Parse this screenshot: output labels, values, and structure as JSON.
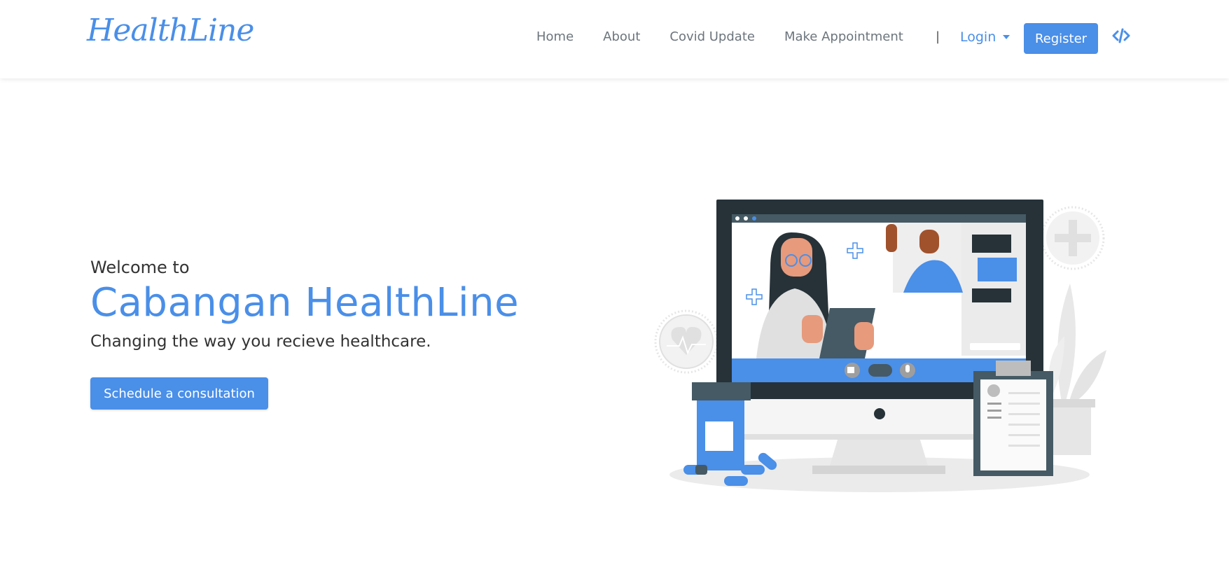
{
  "header": {
    "brand": "HealthLine",
    "nav": [
      "Home",
      "About",
      "Covid Update",
      "Make Appointment"
    ],
    "separator": "|",
    "login_label": "Login",
    "register_label": "Register",
    "code_icon": "code-icon"
  },
  "hero": {
    "welcome": "Welcome to",
    "headline": "Cabangan HealthLine",
    "tagline": "Changing the way you recieve healthcare.",
    "cta_label": "Schedule a consultation"
  },
  "colors": {
    "accent": "#4a8fe8",
    "nav_text": "#6c757d",
    "dark": "#263238"
  }
}
